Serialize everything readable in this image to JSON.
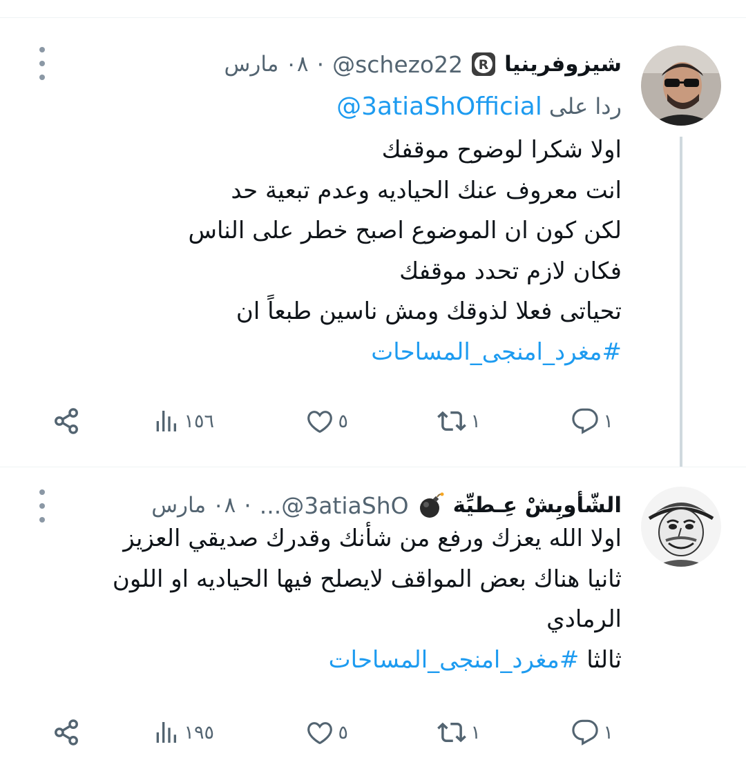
{
  "tweets": [
    {
      "display_name": "شيزوفرينيا",
      "handle": "@schezo22",
      "dot": "·",
      "date": "٠٨ مارس",
      "reply_prefix": "ردا على",
      "reply_mention": "@3atiaShOfficial",
      "lines": [
        "اولا شكرا لوضوح موقفك",
        "انت معروف عنك الحياديه وعدم تبعية حد",
        "لكن كون ان الموضوع اصبح خطر على الناس",
        "فكان لازم تحدد موقفك",
        "تحياتى فعلا لذوقك ومش ناسين طبعاً ان"
      ],
      "hashtag": "#مغرد_امنجى_المساحات",
      "actions": {
        "replies": "١",
        "retweets": "١",
        "likes": "٥",
        "views": "١٥٦"
      }
    },
    {
      "display_name": "الشّأوبِشْ عِـطيِّة",
      "handle": "...@3atiaShO",
      "dot": "·",
      "date": "٠٨ مارس",
      "lines": [
        "اولا الله يعزك ورفع من شأنك وقدرك صديقي العزيز",
        "ثانيا هناك بعض المواقف لايصلح فيها الحياديه او اللون الرمادي"
      ],
      "last_prefix": "ثالثا",
      "hashtag": "#مغرد_امنجى_المساحات",
      "actions": {
        "replies": "١",
        "retweets": "١",
        "likes": "٥",
        "views": "١٩٥"
      }
    }
  ],
  "icons": [
    "registered-badge-icon",
    "bomb-emoji-icon",
    "more-vertical-icon",
    "reply-icon",
    "retweet-icon",
    "like-icon",
    "views-icon",
    "share-icon"
  ],
  "colors": {
    "link_blue": "#1d9bf0",
    "secondary_text": "#536471",
    "primary_text": "#0f1419",
    "thread_line": "#cfd9de"
  }
}
